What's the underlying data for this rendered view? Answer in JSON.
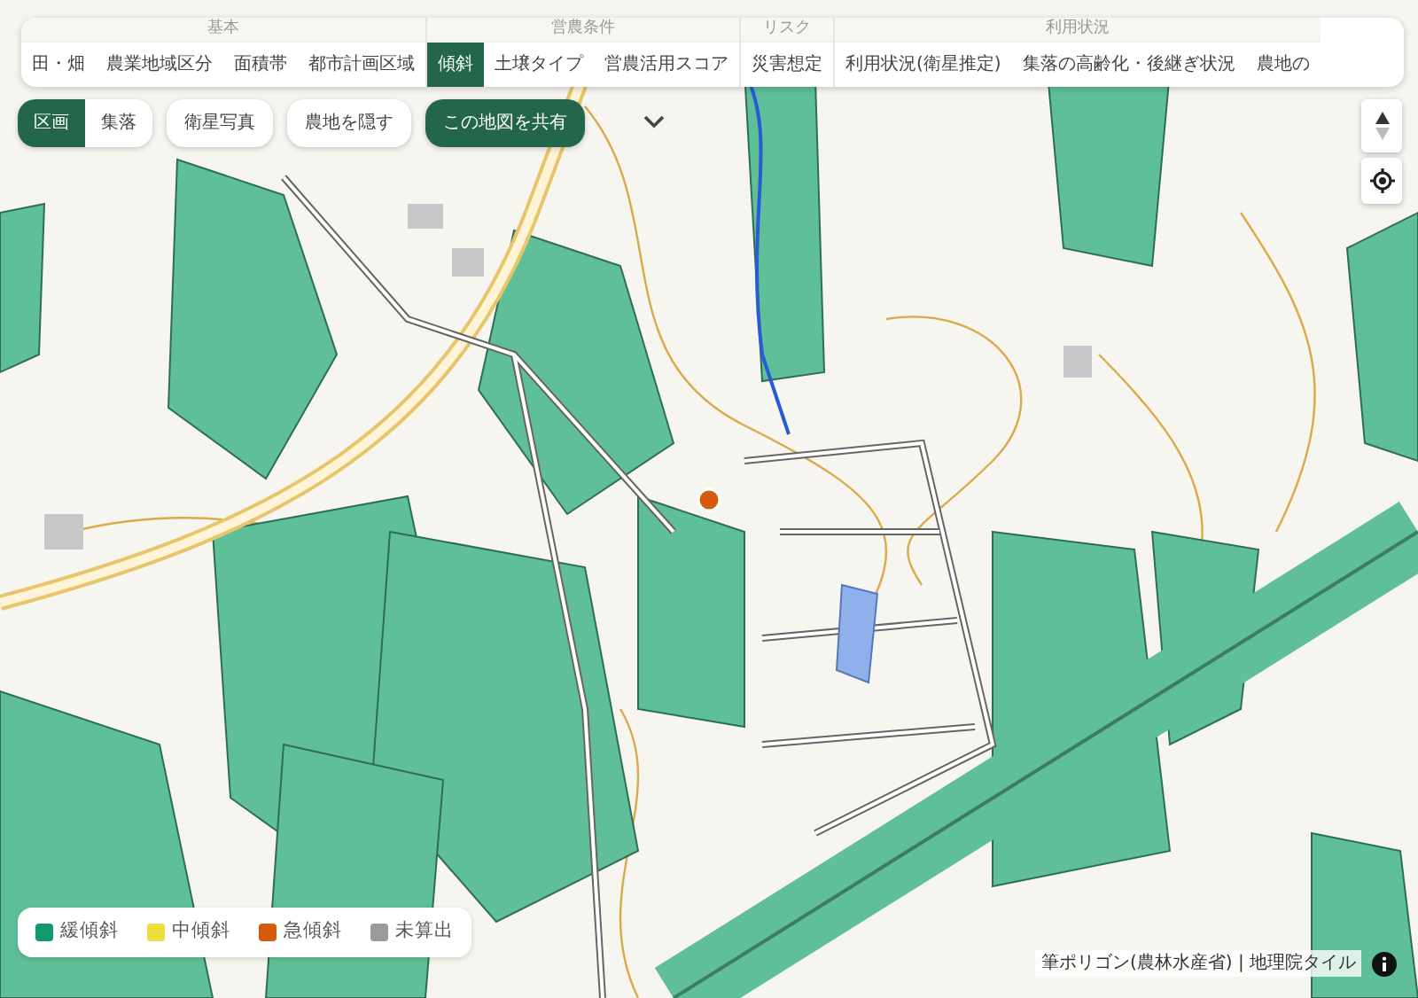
{
  "tab_groups": [
    {
      "title": "基本",
      "tabs": [
        {
          "label": "田・畑",
          "selected": false
        },
        {
          "label": "農業地域区分",
          "selected": false
        },
        {
          "label": "面積帯",
          "selected": false
        },
        {
          "label": "都市計画区域",
          "selected": false
        }
      ]
    },
    {
      "title": "営農条件",
      "tabs": [
        {
          "label": "傾斜",
          "selected": true
        },
        {
          "label": "土壌タイプ",
          "selected": false
        },
        {
          "label": "営農活用スコア",
          "selected": false
        }
      ]
    },
    {
      "title": "リスク",
      "tabs": [
        {
          "label": "災害想定",
          "selected": false
        }
      ]
    },
    {
      "title": "利用状況",
      "tabs": [
        {
          "label": "利用状況(衛星推定)",
          "selected": false
        },
        {
          "label": "集落の高齢化・後継ぎ状況",
          "selected": false
        },
        {
          "label": "農地の",
          "selected": false
        }
      ]
    }
  ],
  "view_toggle": [
    {
      "label": "区画",
      "selected": true
    },
    {
      "label": "集落",
      "selected": false
    }
  ],
  "buttons": [
    {
      "label": "衛星写真",
      "kind": "plain"
    },
    {
      "label": "農地を隠す",
      "kind": "plain"
    },
    {
      "label": "この地図を共有",
      "kind": "primary"
    }
  ],
  "legend": [
    {
      "label": "緩傾斜",
      "color": "#139a6b"
    },
    {
      "label": "中傾斜",
      "color": "#ecdc3c"
    },
    {
      "label": "急傾斜",
      "color": "#d65a0c"
    },
    {
      "label": "未算出",
      "color": "#9a9a9a"
    }
  ],
  "attribution": "筆ポリゴン(農林水産省) | 地理院タイル"
}
